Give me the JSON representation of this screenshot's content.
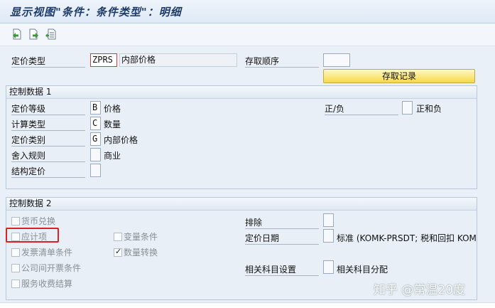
{
  "title": "显示视图\"条件：条件类型\"：明细",
  "toolbar": {
    "icons": [
      "prev-entry-icon",
      "next-entry-icon",
      "other-entry-icon"
    ]
  },
  "header": {
    "pricing_type_label": "定价类型",
    "pricing_type_value": "ZPRS",
    "pricing_type_desc": "内部价格",
    "access_seq_label": "存取顺序",
    "access_seq_value": "",
    "records_button": "存取记录"
  },
  "group1": {
    "title": "控制数据 1",
    "rows": [
      {
        "label": "定价等级",
        "value": "B",
        "desc": "价格"
      },
      {
        "label": "计算类型",
        "value": "C",
        "desc": "数量"
      },
      {
        "label": "定价类别",
        "value": "G",
        "desc": "内部价格"
      },
      {
        "label": "舍入规则",
        "value": "",
        "desc": "商业"
      },
      {
        "label": "结构定价",
        "value": "",
        "desc": ""
      }
    ],
    "plus_minus_label": "正/负",
    "plus_minus_value": "",
    "plus_minus_desc": "正和负"
  },
  "group2": {
    "title": "控制数据 2",
    "left_checks": [
      {
        "label": "货币兑换",
        "checked": false
      },
      {
        "label": "应计项",
        "checked": false
      },
      {
        "label": "发票清单条件",
        "checked": false
      },
      {
        "label": "公司间开票条件",
        "checked": false
      },
      {
        "label": "服务收费结算",
        "checked": false
      }
    ],
    "mid_checks": [
      {
        "label": "变量条件",
        "checked": false
      },
      {
        "label": "数量转换",
        "checked": true
      }
    ],
    "exclusion_label": "排除",
    "exclusion_value": "",
    "pricing_date_label": "定价日期",
    "pricing_date_value": "",
    "pricing_date_desc": "标准 (KOMK-PRSDT; 税和回扣 KOM",
    "gl_setting_label": "相关科目设置",
    "gl_setting_value": "",
    "gl_setting_desc": "相关科目分配"
  },
  "watermark": "知乎 @常温20度",
  "colors": {
    "highlight_box": "#e02020",
    "button_yellow": "#f5d94a"
  }
}
